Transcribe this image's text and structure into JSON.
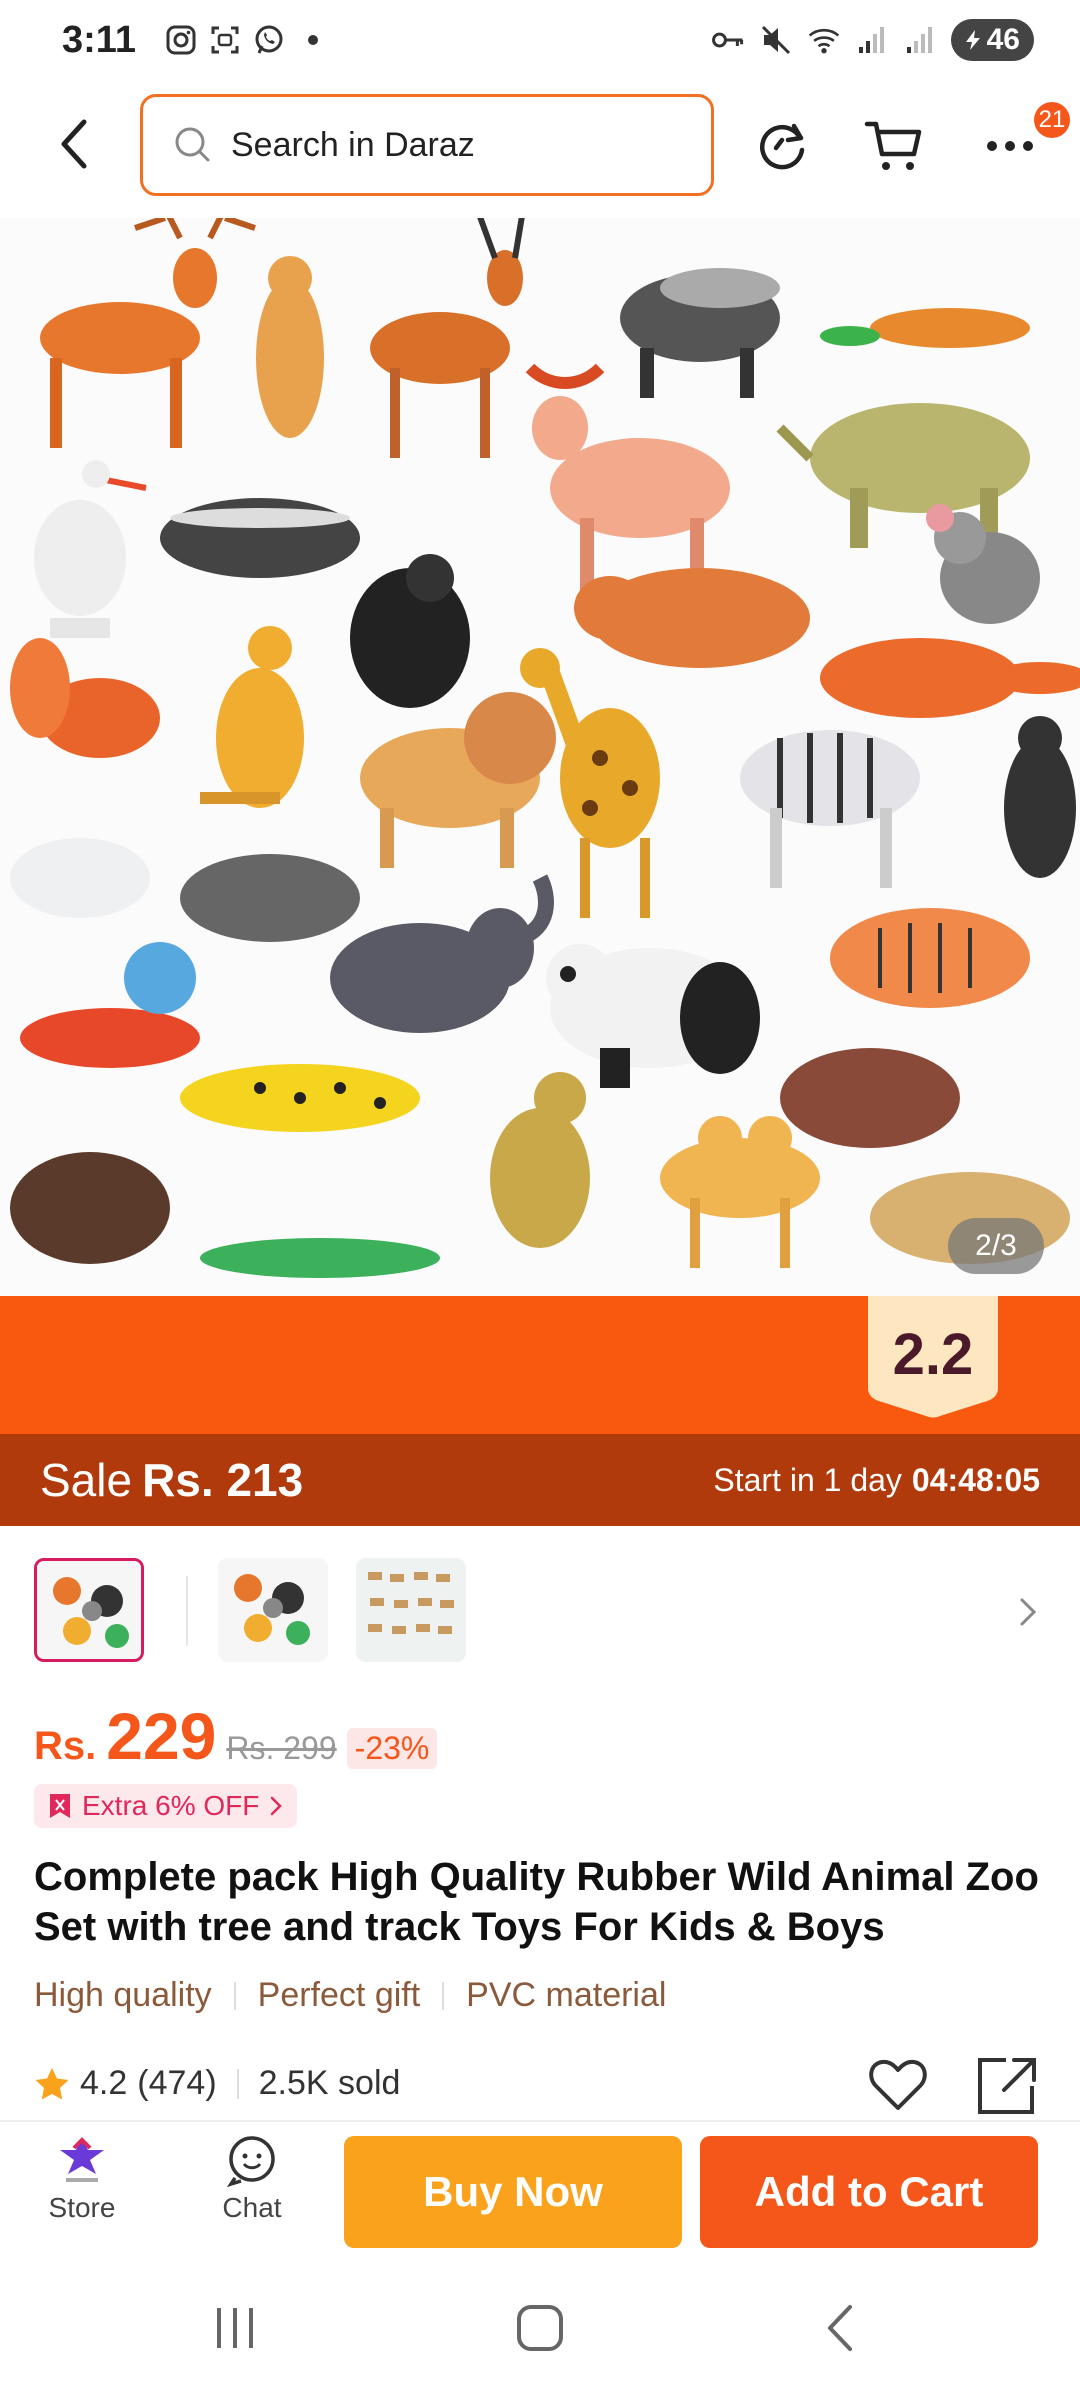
{
  "status_bar": {
    "time": "3:11",
    "battery": "46"
  },
  "header": {
    "search_placeholder": "Search in Daraz",
    "more_badge_count": "21"
  },
  "gallery": {
    "pager": "2/3",
    "thumbnails": [
      "thumb-1",
      "thumb-2",
      "thumb-3"
    ],
    "selected_index": 0
  },
  "promo": {
    "event_label": "2.2",
    "sale_label": "Sale",
    "sale_price": "Rs. 213",
    "start_text": "Start in 1 day",
    "countdown": "04:48:05"
  },
  "price": {
    "currency": "Rs.",
    "current": "229",
    "original": "Rs. 299",
    "discount": "-23%",
    "extra_offer": "Extra 6% OFF"
  },
  "product": {
    "title": "Complete pack High Quality Rubber Wild Animal Zoo Set with tree and track Toys For Kids & Boys",
    "tags": [
      "High quality",
      "Perfect gift",
      "PVC material"
    ],
    "rating": "4.2",
    "reviews": "(474)",
    "sold": "2.5K sold"
  },
  "bottom_bar": {
    "store_label": "Store",
    "chat_label": "Chat",
    "buy_now_label": "Buy Now",
    "add_to_cart_label": "Add to Cart"
  },
  "colors": {
    "brand_orange": "#f5561a",
    "buy_now_yellow": "#faa21c",
    "sale_banner": "#b03a0c",
    "promo_orange": "#f8590f",
    "tag_text": "#8a5a3a"
  }
}
